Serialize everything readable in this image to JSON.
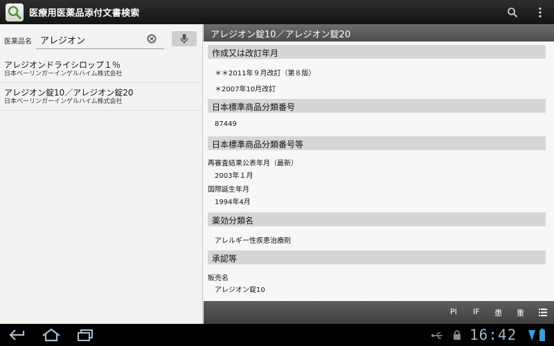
{
  "app": {
    "title": "医療用医薬品添付文書検索"
  },
  "search": {
    "label": "医薬品名",
    "value": "アレジオン"
  },
  "results": [
    {
      "title": "アレジオンドライシロップ１％",
      "company": "日本ベーリンガーインゲルハイム株式会社"
    },
    {
      "title": "アレジオン錠10／アレジオン錠20",
      "company": "日本ベーリンガーインゲルハイム株式会社"
    }
  ],
  "detail": {
    "header": "アレジオン錠10／アレジオン錠20",
    "sections": [
      {
        "title": "作成又は改訂年月",
        "lines": [
          "＊＊2011年９月改訂（第８版）",
          "＊2007年10月改訂"
        ]
      },
      {
        "title": "日本標準商品分類番号",
        "lines": [
          "87449"
        ]
      },
      {
        "title": "日本標準商品分類番号等",
        "fields": [
          {
            "label": "再審査結果公表年月（最新）",
            "value": "2003年１月"
          },
          {
            "label": "国際誕生年月",
            "value": "1994年4月"
          }
        ]
      },
      {
        "title": "薬効分類名",
        "lines": [
          "アレルギー性疾患治療剤"
        ]
      },
      {
        "title": "承認等",
        "fields": [
          {
            "label": "販売名",
            "value": "アレジオン錠10"
          }
        ]
      }
    ]
  },
  "bottom_tabs": [
    "PI",
    "IF",
    "患",
    "重"
  ],
  "status": {
    "time": "16:42"
  },
  "icons": [
    "app-icon",
    "search-icon",
    "overflow-menu-icon",
    "clear-icon",
    "mic-icon",
    "list-icon",
    "back-icon",
    "home-icon",
    "recent-apps-icon",
    "usb-icon",
    "lock-icon",
    "signal-icon",
    "battery-icon"
  ]
}
